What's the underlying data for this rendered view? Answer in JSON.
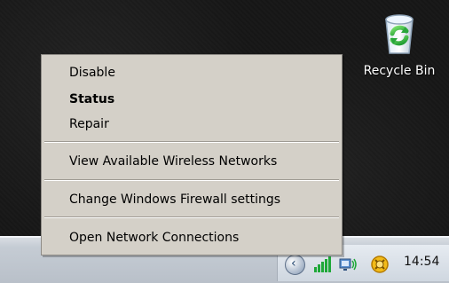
{
  "desktop": {
    "icons": [
      {
        "label": "Recycle Bin",
        "icon": "recycle-bin-icon"
      }
    ]
  },
  "menu": {
    "items": [
      {
        "label": "Disable",
        "bold": false
      },
      {
        "label": "Status",
        "bold": true
      },
      {
        "label": "Repair",
        "bold": false
      },
      {
        "label": "View Available Wireless Networks",
        "bold": false
      },
      {
        "label": "Change Windows Firewall settings",
        "bold": false
      },
      {
        "label": "Open Network Connections",
        "bold": false
      }
    ]
  },
  "taskbar": {
    "tray": {
      "clock": "14:54",
      "buttons": [
        {
          "icon": "chevron-left-icon"
        },
        {
          "icon": "wireless-signal-icon"
        },
        {
          "icon": "network-connection-icon"
        },
        {
          "icon": "security-alert-icon"
        }
      ]
    }
  },
  "colors": {
    "desktop_background": "#171717",
    "menu_background": "#d4d0c8",
    "taskbar_background": "#c5ccd4",
    "text": "#000000",
    "desktop_text": "#ffffff"
  }
}
